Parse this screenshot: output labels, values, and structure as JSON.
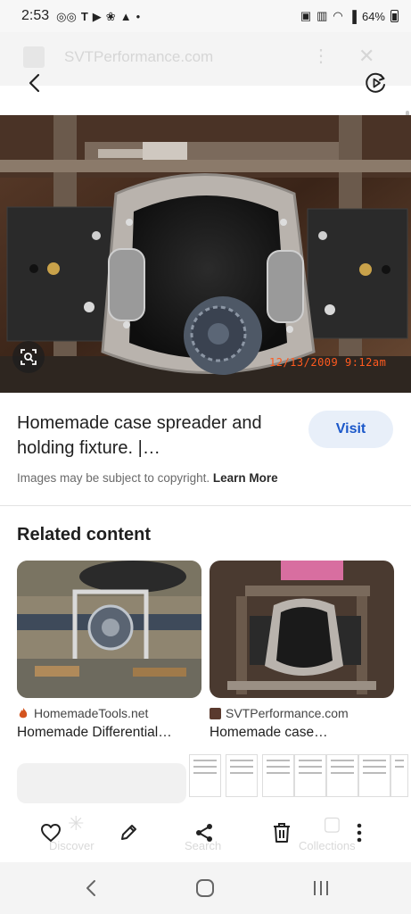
{
  "status": {
    "time": "2:53",
    "left_icons": [
      "voicemail-icon",
      "tmobile-icon",
      "play-icon",
      "pinwheel-icon",
      "bell-icon",
      "dot-icon"
    ],
    "right_icons": [
      "alarm-icon",
      "vibrate-icon",
      "wifi-icon",
      "signal-icon"
    ],
    "battery": "64%"
  },
  "background_page": {
    "site_title": "SVTPerformance.com"
  },
  "hero": {
    "timestamp": "12/13/2009  9:12am"
  },
  "result": {
    "title": "Homemade case spreader and holding fixture. |…",
    "visit_label": "Visit",
    "copyright_text": "Images may be subject to copyright.",
    "learn_more": "Learn More"
  },
  "related": {
    "heading": "Related content",
    "cards": [
      {
        "source": "HomemadeTools.net",
        "title": "Homemade Differential…"
      },
      {
        "source": "SVTPerformance.com",
        "title": "Homemade case…"
      }
    ]
  },
  "ghost_nav": {
    "discover": "Discover",
    "search": "Search",
    "collections": "Collections"
  },
  "actions": [
    "heart-icon",
    "pencil-icon",
    "share-icon",
    "trash-icon",
    "more-vert-icon"
  ],
  "system_nav": [
    "back-icon",
    "home-icon",
    "recents-icon"
  ],
  "colors": {
    "accent": "#1a57c9",
    "visit_bg": "#e8eff9",
    "timestamp": "#ff5a1f"
  }
}
